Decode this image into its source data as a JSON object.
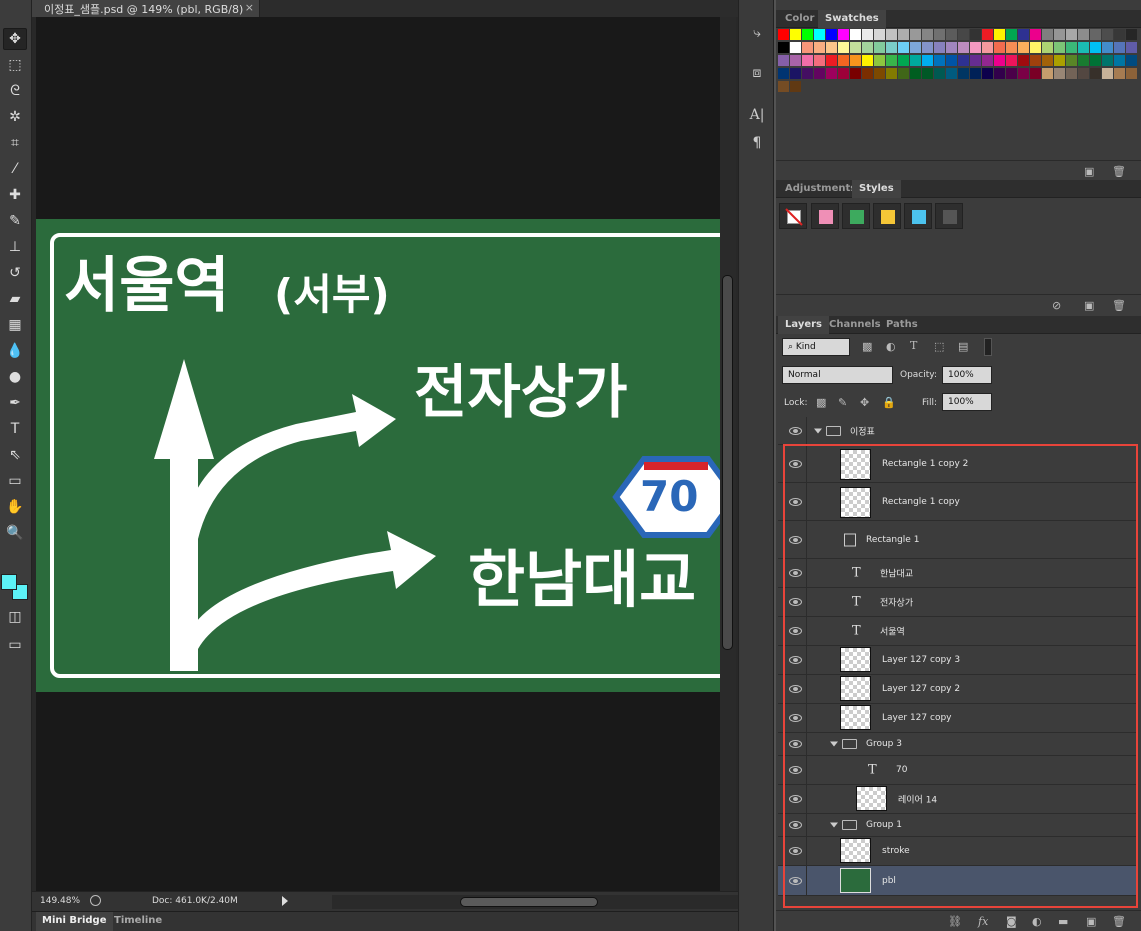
{
  "document": {
    "tab_title": "이정표_샘플.psd @ 149% (pbl, RGB/8)",
    "close_glyph": "×",
    "zoom": "149.48%",
    "doc_size": "Doc: 461.0K/2.40M"
  },
  "bottom_tabs": [
    "Mini Bridge",
    "Timeline"
  ],
  "sign": {
    "line1_main": "서울역",
    "line1_sub": "(서부)",
    "line2": "전자상가",
    "route_number": "70",
    "line3": "한남대교",
    "background": "#2b6b3c"
  },
  "panels": {
    "color_tabs": [
      "Color",
      "Swatches"
    ],
    "adjust_tabs": [
      "Adjustments",
      "Styles"
    ],
    "layers_tabs": [
      "Layers",
      "Channels",
      "Paths"
    ],
    "filter_kind": "Kind",
    "blend_mode": "Normal",
    "opacity_label": "Opacity:",
    "opacity_value": "100%",
    "lock_label": "Lock:",
    "fill_label": "Fill:",
    "fill_value": "100%"
  },
  "swatches": [
    [
      "#ff0000",
      "#ffff00",
      "#00ff00",
      "#00ffff",
      "#0000ff",
      "#ff00ff",
      "#ffffff",
      "#ebebeb",
      "#d6d6d6",
      "#c2c2c2",
      "#adadad",
      "#999999",
      "#858585",
      "#707070",
      "#5c5c5c",
      "#474747",
      "#333333",
      "#ed1c24",
      "#fff200",
      "#00a651",
      "#2e3192",
      "#ec008c",
      "#7f7f7f",
      "#969696",
      "#a8a8a8",
      "#8d8d8d",
      "#666666",
      "#4d4d4d",
      "#383838",
      "#262626"
    ],
    [
      "#000000",
      "#ffffff",
      "#f69679",
      "#f9ad81",
      "#fdc68a",
      "#fff799",
      "#c4df9b",
      "#a3d39c",
      "#82ca9c",
      "#7accc8",
      "#6dcff6",
      "#7da7d9",
      "#8393ca",
      "#8781bd",
      "#a186be",
      "#bd8cbf",
      "#f49ac1",
      "#f5989d",
      "#f26c4f",
      "#f68e55",
      "#fbaf5c",
      "#fff467",
      "#acd372",
      "#7cc576",
      "#3bb878",
      "#1abbb4",
      "#00bff3",
      "#438ccb",
      "#5574b9",
      "#605ca8"
    ],
    [
      "#855fa8",
      "#a763a8",
      "#f06ea9",
      "#f26d7d",
      "#ed1c24",
      "#f26522",
      "#f7941d",
      "#fff200",
      "#8dc63f",
      "#39b54a",
      "#00a651",
      "#00a99d",
      "#00aeef",
      "#0072bc",
      "#0054a6",
      "#2e3192",
      "#662d91",
      "#92278f",
      "#ec008c",
      "#ed145b",
      "#9e0b0f",
      "#a0410d",
      "#a36209",
      "#aba000",
      "#598527",
      "#197b30",
      "#007236",
      "#00746b",
      "#0076a3",
      "#004b80"
    ],
    [
      "#003471",
      "#1b1464",
      "#440e62",
      "#630460",
      "#9e005d",
      "#9e0039",
      "#790000",
      "#7b2e00",
      "#7d4900",
      "#827b00",
      "#406618",
      "#005e20",
      "#005826",
      "#005952",
      "#005b7f",
      "#003663",
      "#002157",
      "#0d004c",
      "#32004b",
      "#4b0049",
      "#7b0046",
      "#7a0026",
      "#c69c6d",
      "#998675",
      "#736357",
      "#534741",
      "#37302a",
      "#c7b299",
      "#a67c52",
      "#8c6239"
    ],
    [
      "#754c24",
      "#603913"
    ]
  ],
  "styles": [
    "#ef8fb6",
    "#3daa5e",
    "#f5c637",
    "#4cc3ee",
    "#555555"
  ],
  "layers": [
    {
      "name": "이정표",
      "kind": "group",
      "indent": 0
    },
    {
      "name": "Rectangle 1 copy 2",
      "kind": "shape",
      "indent": 1
    },
    {
      "name": "Rectangle 1 copy",
      "kind": "shape",
      "indent": 1
    },
    {
      "name": "Rectangle 1",
      "kind": "shape-small",
      "indent": 1
    },
    {
      "name": "한남대교",
      "kind": "text",
      "indent": 1
    },
    {
      "name": "전자상가",
      "kind": "text",
      "indent": 1
    },
    {
      "name": "서울역",
      "kind": "text",
      "indent": 1
    },
    {
      "name": "Layer 127 copy 3",
      "kind": "pixel",
      "indent": 1
    },
    {
      "name": "Layer 127 copy 2",
      "kind": "pixel",
      "indent": 1
    },
    {
      "name": "Layer 127 copy",
      "kind": "pixel",
      "indent": 1
    },
    {
      "name": "Group 3",
      "kind": "group",
      "indent": 1
    },
    {
      "name": "70",
      "kind": "text",
      "indent": 2
    },
    {
      "name": "레이어 14",
      "kind": "pixel",
      "indent": 2
    },
    {
      "name": "Group 1",
      "kind": "group",
      "indent": 1
    },
    {
      "name": "stroke",
      "kind": "pixel",
      "indent": 1
    },
    {
      "name": "pbl",
      "kind": "fill",
      "indent": 1,
      "selected": true
    }
  ],
  "layer_footer_icons": [
    "link-icon",
    "fx-icon",
    "mask-icon",
    "adjustment-icon",
    "folder-icon",
    "new-layer-icon",
    "trash-icon"
  ],
  "footer_glyphs": {
    "fx": "fx",
    "trash": "🗑"
  },
  "tools": [
    {
      "name": "move-tool",
      "glyph": "✥",
      "sel": true
    },
    {
      "name": "marquee-tool",
      "glyph": "⬚"
    },
    {
      "name": "lasso-tool",
      "glyph": "ᘓ"
    },
    {
      "name": "magic-wand-tool",
      "glyph": "✲"
    },
    {
      "name": "crop-tool",
      "glyph": "⌗"
    },
    {
      "name": "eyedropper-tool",
      "glyph": "⁄"
    },
    {
      "name": "healing-brush-tool",
      "glyph": "✚"
    },
    {
      "name": "brush-tool",
      "glyph": "✎"
    },
    {
      "name": "stamp-tool",
      "glyph": "⊥"
    },
    {
      "name": "history-brush-tool",
      "glyph": "↺"
    },
    {
      "name": "eraser-tool",
      "glyph": "▰"
    },
    {
      "name": "gradient-tool",
      "glyph": "▦"
    },
    {
      "name": "blur-tool",
      "glyph": "💧"
    },
    {
      "name": "dodge-tool",
      "glyph": "●"
    },
    {
      "name": "pen-tool",
      "glyph": "✒"
    },
    {
      "name": "type-tool",
      "glyph": "T"
    },
    {
      "name": "path-selection-tool",
      "glyph": "⇖"
    },
    {
      "name": "rectangle-tool",
      "glyph": "▭"
    },
    {
      "name": "hand-tool",
      "glyph": "✋"
    },
    {
      "name": "zoom-tool",
      "glyph": "🔍"
    }
  ],
  "foreground_color": "#5cf2f6",
  "background_color": "#5cf2f6"
}
